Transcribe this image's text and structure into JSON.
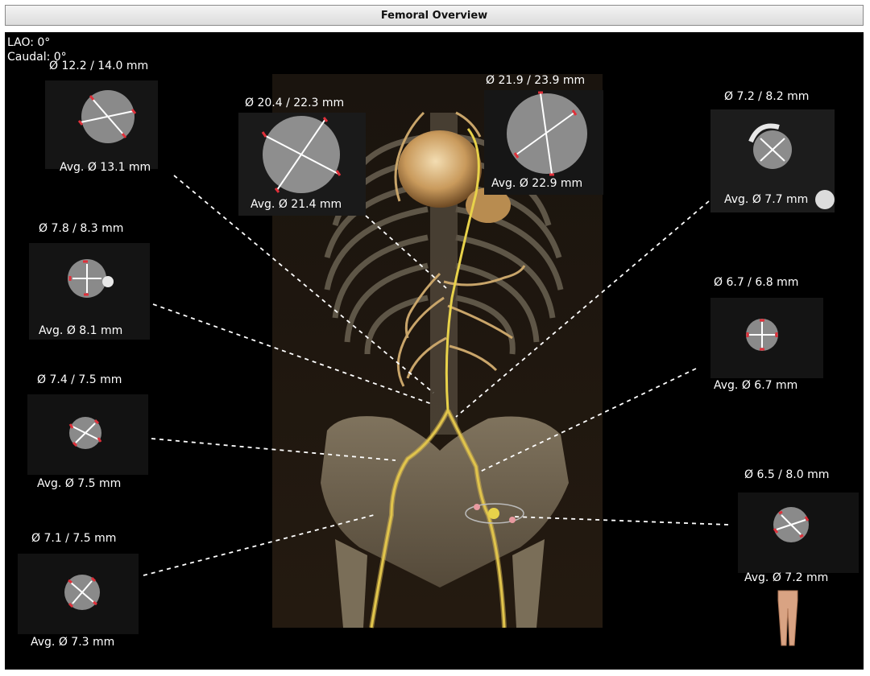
{
  "window": {
    "title": "Femoral Overview"
  },
  "orientation": {
    "lao": "LAO: 0°",
    "caudal": "Caudal: 0°"
  },
  "cross_sections": [
    {
      "id": "top-left",
      "diameters": "Ø 12.2 / 14.0 mm",
      "average": "Avg. Ø 13.1 mm"
    },
    {
      "id": "top-center-left",
      "diameters": "Ø 20.4 / 22.3 mm",
      "average": "Avg. Ø 21.4 mm"
    },
    {
      "id": "top-center-right",
      "diameters": "Ø 21.9 / 23.9 mm",
      "average": "Avg. Ø 22.9 mm"
    },
    {
      "id": "top-right",
      "diameters": "Ø 7.2 / 8.2 mm",
      "average": "Avg. Ø 7.7 mm"
    },
    {
      "id": "mid-left-upper",
      "diameters": "Ø 7.8 / 8.3 mm",
      "average": "Avg. Ø 8.1 mm"
    },
    {
      "id": "mid-right",
      "diameters": "Ø 6.7 / 6.8 mm",
      "average": "Avg. Ø 6.7 mm"
    },
    {
      "id": "mid-left-lower",
      "diameters": "Ø 7.4 / 7.5 mm",
      "average": "Avg. Ø 7.5 mm"
    },
    {
      "id": "bottom-right",
      "diameters": "Ø 6.5 / 8.0 mm",
      "average": "Avg. Ø 7.2 mm"
    },
    {
      "id": "bottom-left",
      "diameters": "Ø 7.1 / 7.5 mm",
      "average": "Avg. Ø 7.3 mm"
    }
  ],
  "colors": {
    "vessel": "#e8d24a",
    "marker_red": "#e0303a",
    "leader": "#ffffff"
  }
}
